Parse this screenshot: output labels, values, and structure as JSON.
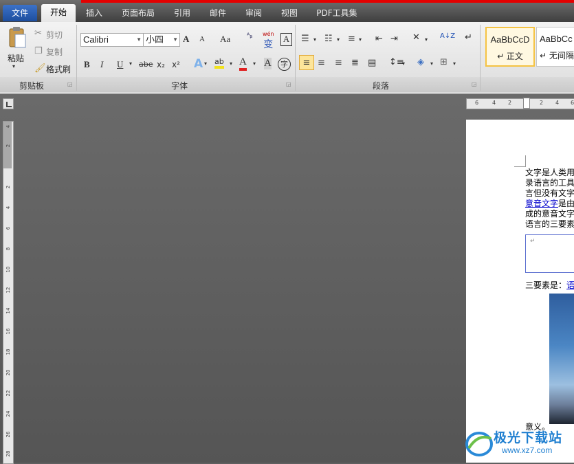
{
  "tabs": {
    "file": "文件",
    "home": "开始",
    "insert": "插入",
    "layout": "页面布局",
    "references": "引用",
    "mailings": "邮件",
    "review": "审阅",
    "view": "视图",
    "pdf": "PDF工具集"
  },
  "clipboard": {
    "paste": "粘贴",
    "cut": "剪切",
    "copy": "复制",
    "format_painter": "格式刷",
    "group_label": "剪贴板"
  },
  "font": {
    "font_name": "Calibri",
    "font_size": "小四",
    "group_label": "字体",
    "bold": "B",
    "italic": "I",
    "underline": "U",
    "strike": "abe",
    "subscript": "x₂",
    "superscript": "x²",
    "grow": "A",
    "shrink": "A",
    "change_case": "Aa",
    "effects": "A",
    "highlight": "ab",
    "color": "A",
    "shade": "A",
    "circle": "字",
    "pinyin": "wén",
    "pinyin_sub": "变"
  },
  "paragraph": {
    "group_label": "段落"
  },
  "styles": {
    "normal_sample": "AaBbCcD",
    "normal_name": "↵ 正文",
    "nospacing_sample": "AaBbCc",
    "nospacing_name": "↵ 无间隔"
  },
  "ruler": {
    "h_ticks": [
      "6",
      "4",
      "2",
      "2",
      "4",
      "6"
    ],
    "v_ticks": [
      "4",
      "2",
      "2",
      "4",
      "6",
      "8",
      "10",
      "12",
      "14",
      "16",
      "18",
      "20",
      "22",
      "24",
      "26",
      "28"
    ]
  },
  "document": {
    "lines": [
      "文字是人类用",
      "录语言的工具",
      "言但没有文字"
    ],
    "link_line_link": "意音文字",
    "link_line_rest": "是由",
    "lines2": [
      "成的意音文字",
      "语言的三要素"
    ],
    "textbox_mark": "↵",
    "three_elements_prefix": "三要素是：",
    "three_elements_link": "语",
    "meaning": "意义。"
  },
  "watermark": {
    "brand": "极光下载站",
    "url": "www.xz7.com"
  }
}
